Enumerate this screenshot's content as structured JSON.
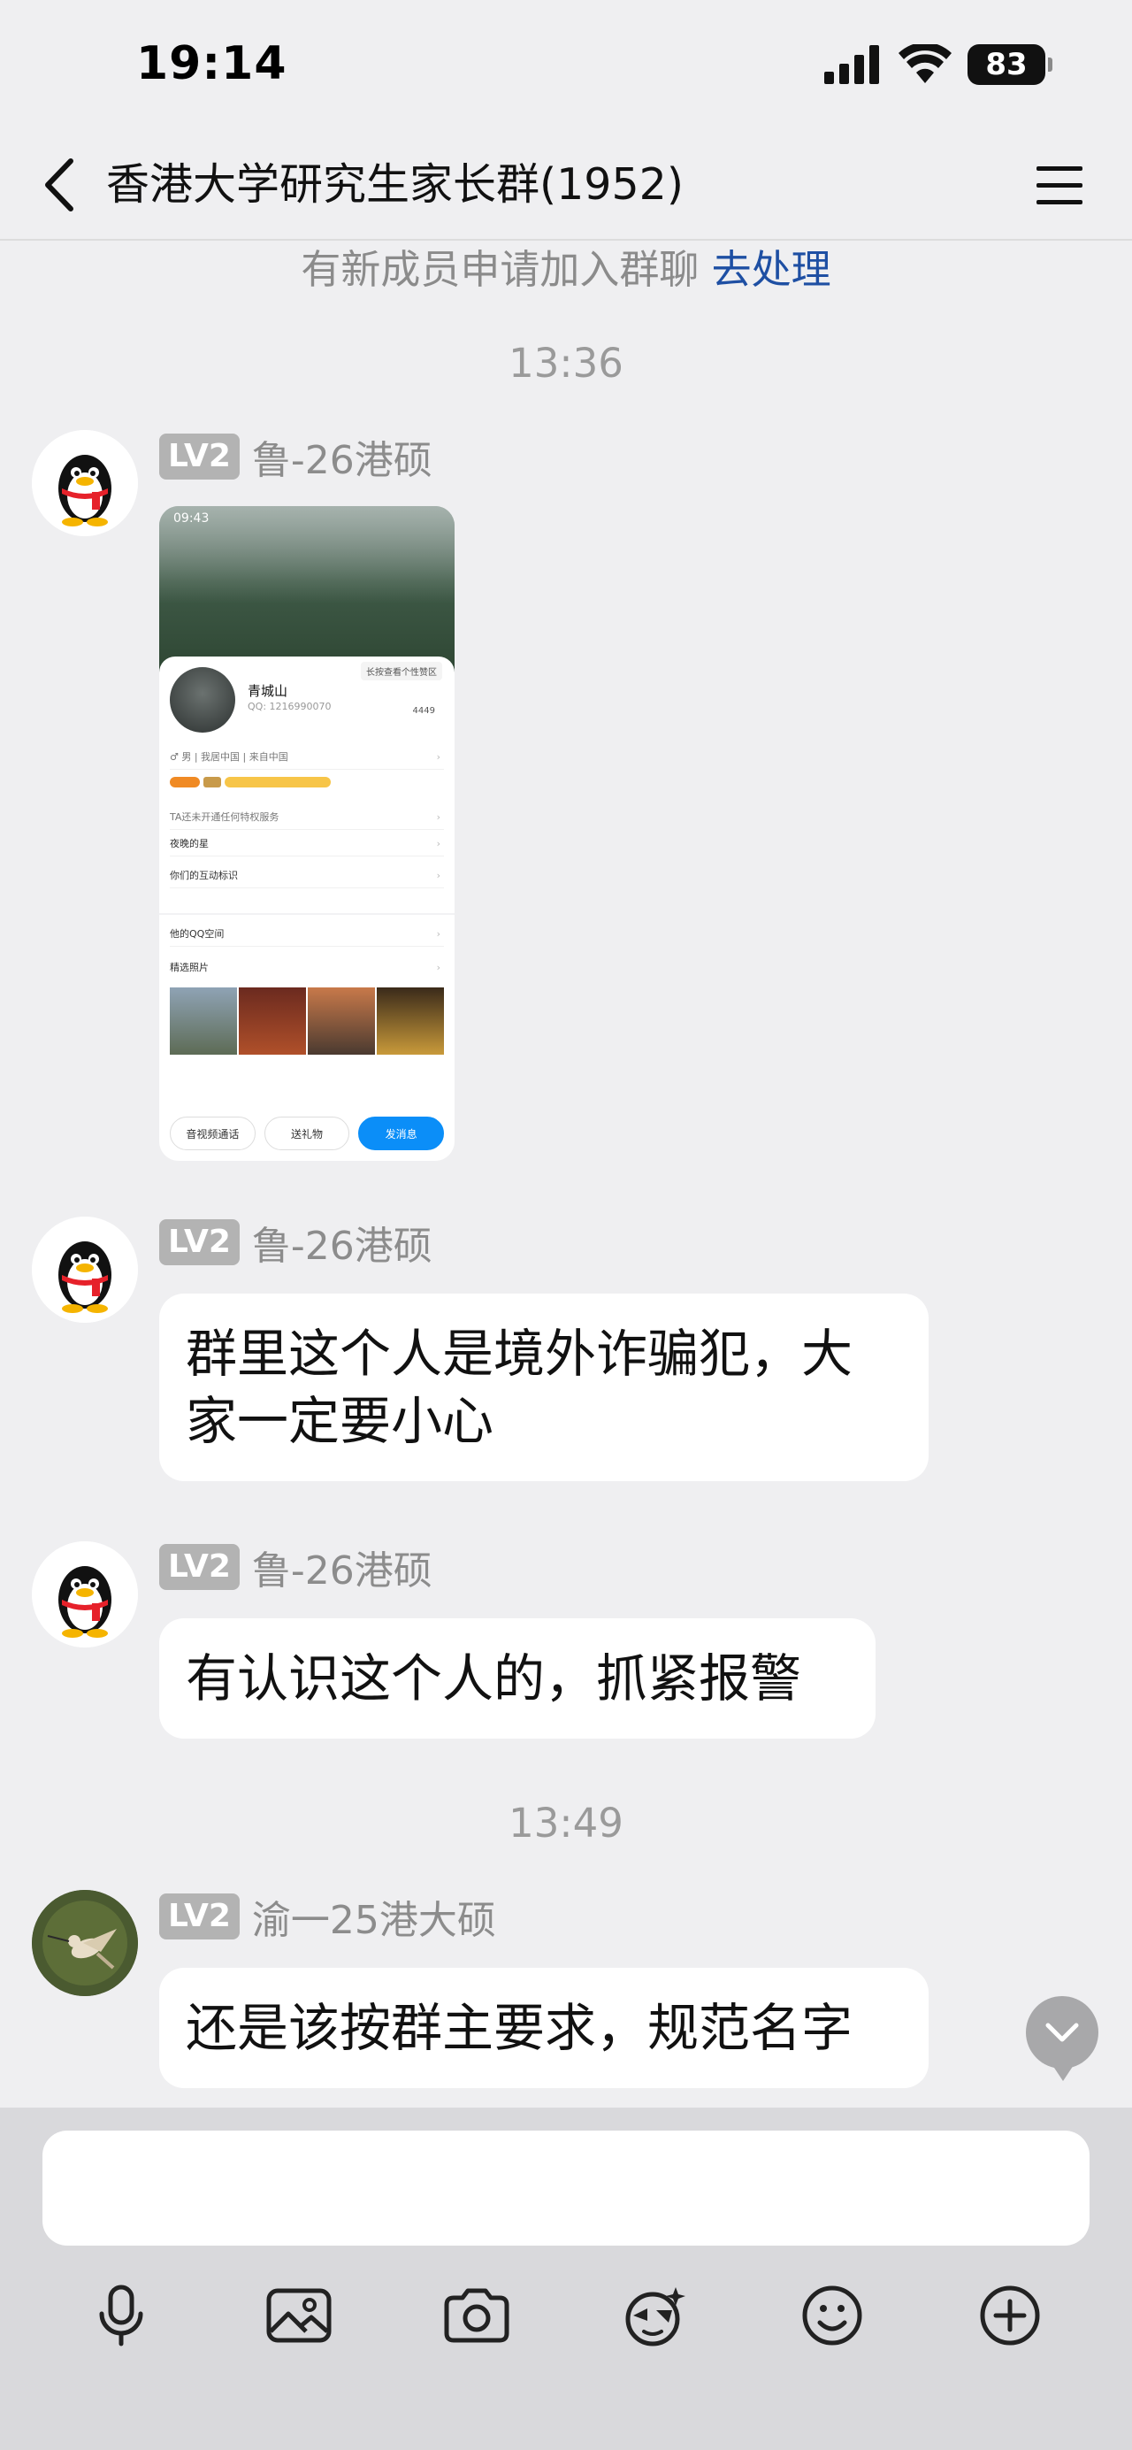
{
  "status_bar": {
    "time": "19:14",
    "battery": "83"
  },
  "header": {
    "title": "香港大学研究生家长群(1952)"
  },
  "system_notice": {
    "text": "有新成员申请加入群聊",
    "action": "去处理"
  },
  "time_separators": [
    "13:36",
    "13:49"
  ],
  "messages": [
    {
      "level": "LV2",
      "sender": "鲁-26港硕",
      "type": "image",
      "image": {
        "status_time": "09:43",
        "profile_name": "青城山",
        "qq": "QQ: 1216990070",
        "hint": "长按查看个性赞区",
        "likes": "4449",
        "rows": [
          "♂ 男 | 我居中国 | 来自中国",
          "TA还未开通任何特权服务",
          "夜晚的星",
          "你们的互动标识"
        ],
        "section_rows": [
          "他的QQ空间",
          "精选照片"
        ],
        "buttons": [
          "音视频通话",
          "送礼物",
          "发消息"
        ]
      }
    },
    {
      "level": "LV2",
      "sender": "鲁-26港硕",
      "type": "text",
      "text_line1": "群里这个人是境外诈骗犯，大",
      "text_line2": "家一定要小心"
    },
    {
      "level": "LV2",
      "sender": "鲁-26港硕",
      "type": "text",
      "text": "有认识这个人的，抓紧报警"
    },
    {
      "level": "LV2",
      "sender": "渝一25港大硕",
      "type": "text",
      "text": "还是该按群主要求，规范名字"
    }
  ],
  "input": {
    "value": ""
  },
  "toolbar": [
    "microphone-icon",
    "image-icon",
    "camera-icon",
    "sticker-icon",
    "emoji-icon",
    "plus-icon"
  ],
  "colors": {
    "background": "#efeff1",
    "link": "#1e4fa3",
    "badge": "#b3b3b3",
    "primary_button": "#0b8ef8"
  }
}
